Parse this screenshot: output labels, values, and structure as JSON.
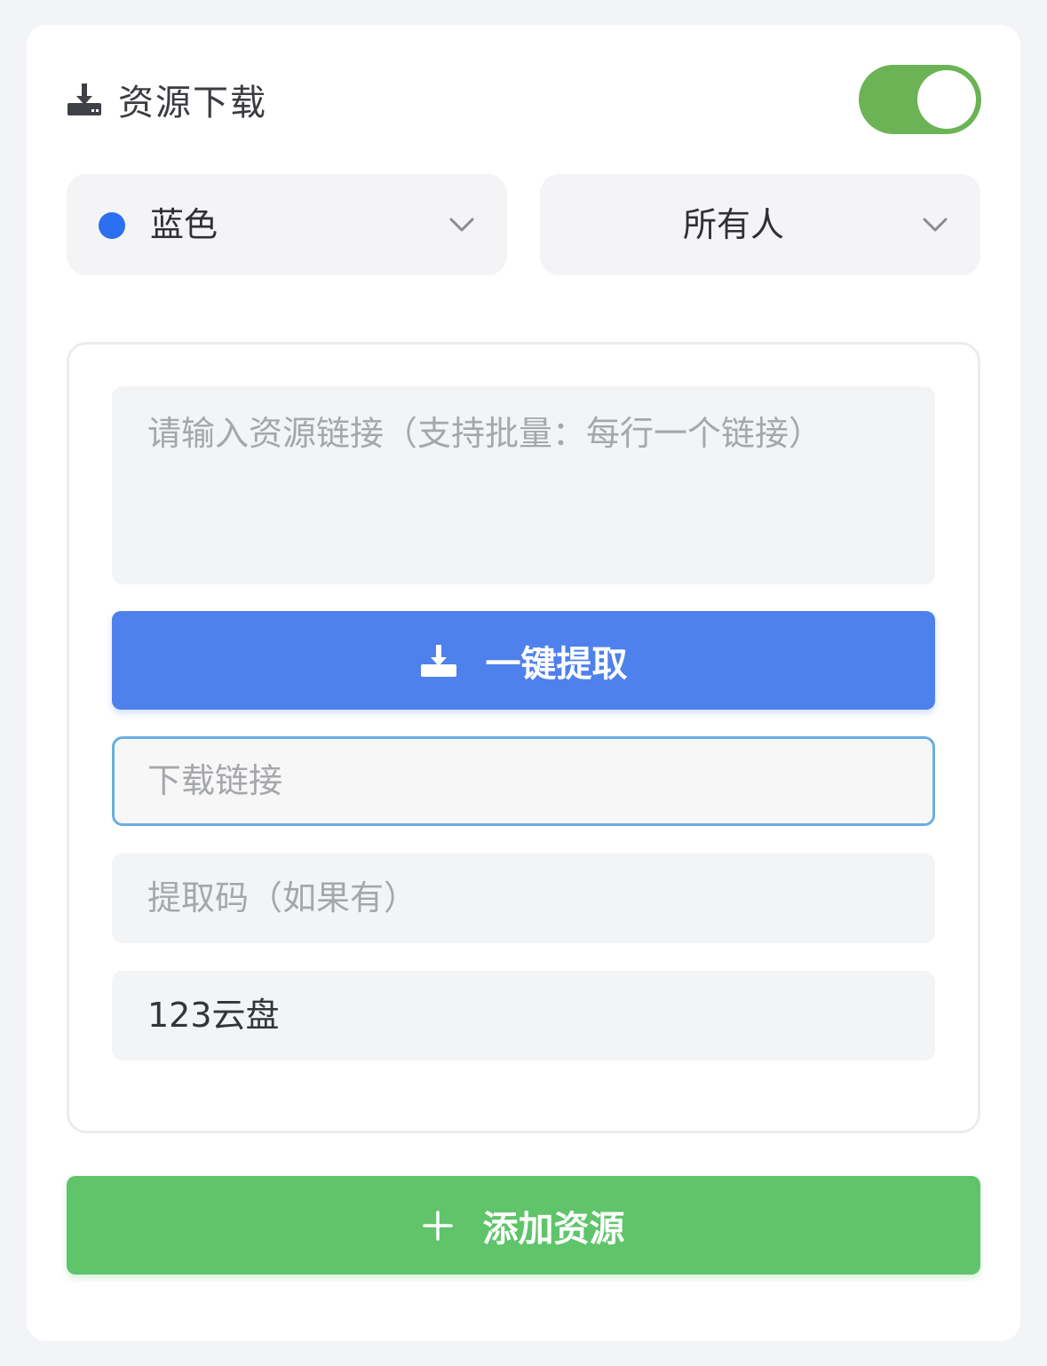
{
  "header": {
    "icon": "download-tray-icon",
    "title": "资源下载",
    "toggle_on": true
  },
  "selects": {
    "color": {
      "label": "蓝色",
      "dot_color": "#2c6ff0",
      "icon": "chevron-down-icon"
    },
    "audience": {
      "label": "所有人",
      "icon": "chevron-down-icon"
    }
  },
  "form": {
    "links_placeholder": "请输入资源链接（支持批量：每行一个链接）",
    "extract_button": {
      "label": "一键提取",
      "icon": "download-tray-icon"
    },
    "download_link_placeholder": "下载链接",
    "code_placeholder": "提取码（如果有）",
    "disk_value": "123云盘"
  },
  "add_button": {
    "label": "添加资源",
    "icon": "plus-icon"
  },
  "colors": {
    "primary_blue": "#4f81ec",
    "success_green": "#5fc46a",
    "toggle_green": "#6cb356"
  }
}
